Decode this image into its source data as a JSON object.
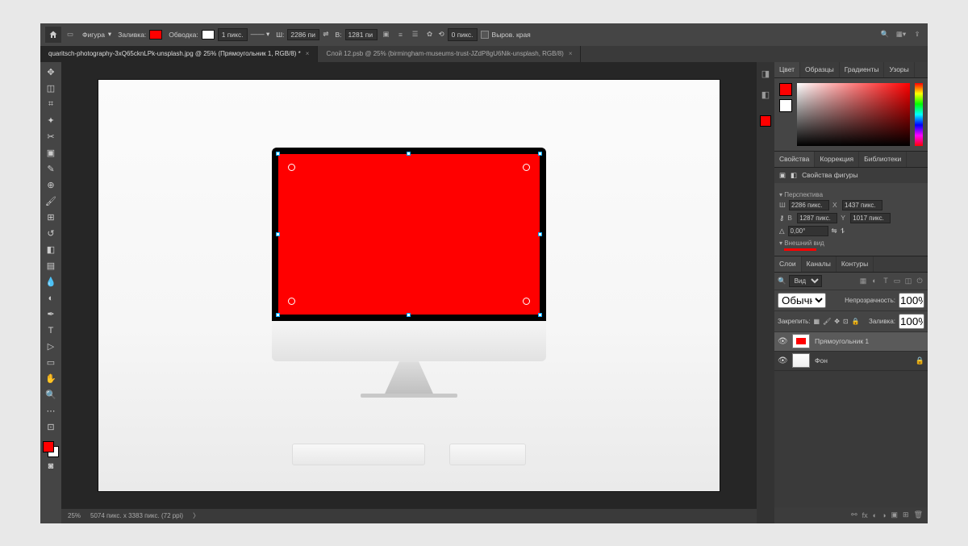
{
  "options_bar": {
    "shape_label": "Фигура",
    "fill_label": "Заливка:",
    "stroke_label": "Обводка:",
    "stroke_width": "1 пикс.",
    "width_label": "Ш:",
    "width_value": "2286 пи",
    "height_label": "В:",
    "height_value": "1281 пи",
    "radius": "0 пикс.",
    "align_edges_label": "Выров. края"
  },
  "tabs": {
    "active": "quaritsch-photography-3xQ65cknLPk-unsplash.jpg @ 25% (Прямоугольник 1, RGB/8) *",
    "inactive": "Слой 12.psb @ 25% (birmingham-museums-trust-JZdP8gU6Nik-unsplash, RGB/8)"
  },
  "status_bar": {
    "zoom": "25%",
    "dimensions": "5074 пикс. x 3383 пикс. (72 ppi)"
  },
  "panels": {
    "color": {
      "tab1": "Цвет",
      "tab2": "Образцы",
      "tab3": "Градиенты",
      "tab4": "Узоры"
    },
    "properties": {
      "tab1": "Свойства",
      "tab2": "Коррекция",
      "tab3": "Библиотеки",
      "title": "Свойства фигуры",
      "transform_label": "Перспектива",
      "w_label": "Ш",
      "w_value": "2286 пикс.",
      "x_label": "X",
      "x_value": "1437 пикс.",
      "h_label": "В",
      "h_value": "1287 пикс.",
      "y_label": "Y",
      "y_value": "1017 пикс.",
      "angle": "0,00°",
      "appearance_label": "Внешний вид"
    },
    "layers": {
      "tab1": "Слои",
      "tab2": "Каналы",
      "tab3": "Контуры",
      "search": "Вид",
      "blend": "Обычные",
      "opacity_label": "Непрозрачность:",
      "opacity": "100%",
      "lock_label": "Закрепить:",
      "fill_label": "Заливка:",
      "fill": "100%",
      "layer1": "Прямоугольник 1",
      "layer2": "Фон"
    }
  }
}
